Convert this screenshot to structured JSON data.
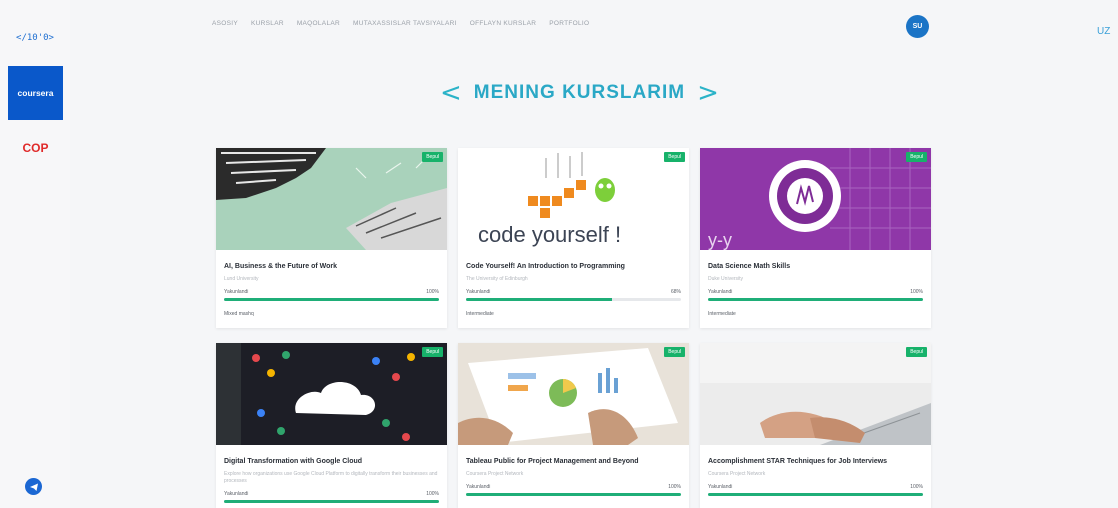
{
  "sidebar": {
    "logo_text": "</10'0>",
    "coursera_label": "coursera",
    "cop_label": "COP"
  },
  "topnav": [
    "ASOSIY",
    "KURSLAR",
    "MAQOLALAR",
    "MUTAXASSISLAR TAVSIYALARI",
    "OFFLAYN KURSLAR",
    "PORTFOLIO"
  ],
  "header": {
    "avatar_initials": "SU",
    "lang": "UZ"
  },
  "page_title": "MENING KURSLARIM",
  "colors": {
    "accent": "#2aa8c6",
    "progress": "#1fae78",
    "badge": "#17b26a",
    "coursera": "#0a58ca",
    "cop": "#e02a2a"
  },
  "cards": [
    {
      "title": "AI, Business & the Future of Work",
      "subtitle": "Lund University",
      "progress_label": "Yakunlandi",
      "percent": "100%",
      "progress": 100,
      "level": "Mixed mashq",
      "badge": "Bepul"
    },
    {
      "title": "Code Yourself! An Introduction to Programming",
      "subtitle": "The University of Edinburgh",
      "progress_label": "Yakunlandi",
      "percent": "68%",
      "progress": 68,
      "level": "Intermediate",
      "badge": "Bepul",
      "thumb_text": "code yourself !"
    },
    {
      "title": "Data Science Math Skills",
      "subtitle": "Duke University",
      "progress_label": "Yakunlandi",
      "percent": "100%",
      "progress": 100,
      "level": "Intermediate",
      "badge": "Bepul"
    },
    {
      "title": "Digital Transformation with Google Cloud",
      "subtitle": "Explore how organizations use Google Cloud Platform to digitally transform their businesses and processes",
      "progress_label": "Yakunlandi",
      "percent": "100%",
      "progress": 100,
      "badge": "Bepul"
    },
    {
      "title": "Tableau Public for Project Management and Beyond",
      "subtitle": "Coursera Project Network",
      "progress_label": "Yakunlandi",
      "percent": "100%",
      "progress": 100,
      "badge": "Bepul"
    },
    {
      "title": "Accomplishment STAR Techniques for Job Interviews",
      "subtitle": "Coursera Project Network",
      "progress_label": "Yakunlandi",
      "percent": "100%",
      "progress": 100,
      "badge": "Bepul"
    }
  ]
}
